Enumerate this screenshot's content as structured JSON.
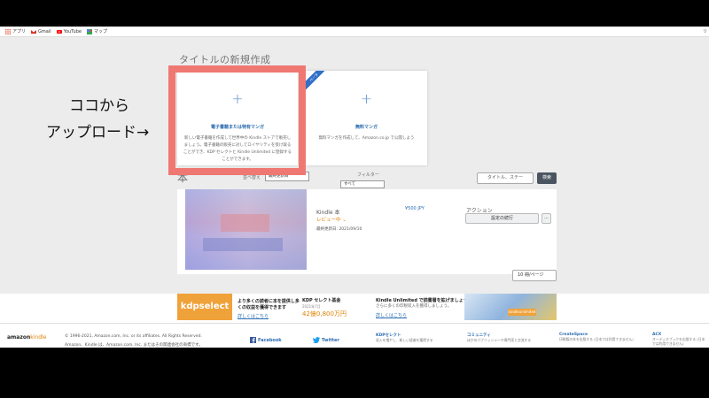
{
  "browser": {
    "bookmarks": [
      {
        "label": "アプリ",
        "icon": "apps-grid-icon"
      },
      {
        "label": "Gmail",
        "icon": "gmail-icon"
      },
      {
        "label": "YouTube",
        "icon": "youtube-icon"
      },
      {
        "label": "マップ",
        "icon": "maps-icon"
      }
    ],
    "right_label": "リ"
  },
  "page": {
    "title": "タイトルの新規作成",
    "ebook_card": {
      "plus": "+",
      "title": "電子書籍または特有マンガ",
      "description": "新しい電子書籍を作成して世界中の Kindle ストアで販売しましょう。電子書籍の販売に対してロイヤリティを受け取ることができ、KDP セレクトと Kindle Unlimited に登録することができます。"
    },
    "manga_card": {
      "plus": "+",
      "ribbon": "ベータ",
      "title": "無料マンガ",
      "description": "無料マンガを作成して、Amazon.co.jp で公開しよう"
    }
  },
  "annotation": {
    "line1": "ココから",
    "line2": "アップロード→"
  },
  "books": {
    "heading": "本",
    "sort_label": "並べ替え",
    "sort_value": "最終更新日",
    "filter_label": "フィルター",
    "filter_value": "すべて",
    "search_placeholder": "タイトル、ステー",
    "search_button": "検索",
    "items": [
      {
        "format": "Kindle 本",
        "status": "レビュー中",
        "updated": "最終更新日: 2021/09/10",
        "price": "¥500 JPY",
        "action_label": "アクション",
        "action_button": "設定の続行",
        "more": "..."
      }
    ],
    "per_page": "10 冊/ページ"
  },
  "promo": {
    "logo": "kdpselect",
    "text1": "より多くの読者に本を提供し多くの収益を獲得できます",
    "link1": "詳しくはこちら",
    "select_title": "KDP セレクト基金",
    "select_month": "2021年7月",
    "select_amount": "42億0,800万円",
    "ku_title": "Kindle Unlimited で読書層を拡げましょう",
    "ku_text": "さらに多くの印税収入を獲得しましょう。",
    "link2": "詳しくはこちら",
    "ku_badge": "kindleunlimited"
  },
  "footer": {
    "logo_main": "amazon",
    "logo_accent": "kindle",
    "copyright1": "© 1996-2021, Amazon.com, Inc. or its affiliates. All Rights Reserved.",
    "copyright2": "Amazon、Kindle は、Amazon.com, Inc. またはその関連会社の商標です。",
    "facebook": "Facebook",
    "twitter": "Twitter",
    "columns": [
      {
        "title": "KDPセレクト",
        "sub": "収入を増やし、新しい読者を獲得する"
      },
      {
        "title": "コミュニティ",
        "sub": "ほかのパブリッシャーや専門家と交流する"
      },
      {
        "title": "CreateSpace",
        "sub": "印刷版の本を出版する (日本では利用できません)"
      },
      {
        "title": "ACX",
        "sub": "オーディオブックを出版する (日本では利用できません)"
      }
    ]
  },
  "colors": {
    "highlight": "#f07872",
    "link": "#2b6cb0",
    "orange": "#e08000"
  }
}
